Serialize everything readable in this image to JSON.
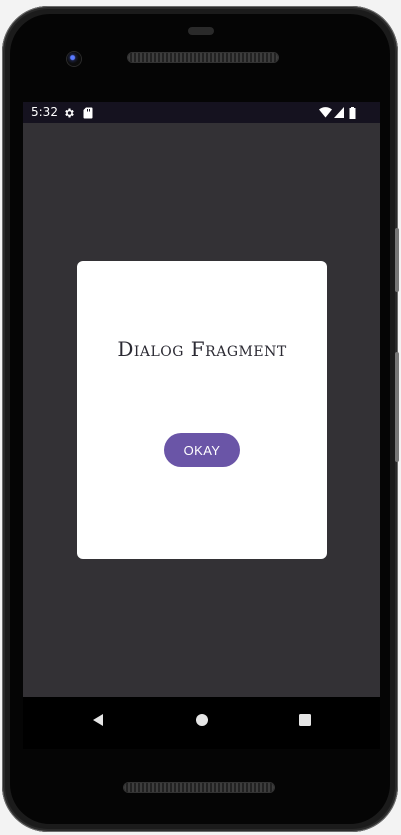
{
  "status_bar": {
    "time": "5:32",
    "icons": [
      "gear-icon",
      "sd-card-icon",
      "wifi-icon",
      "cellular-signal-icon",
      "battery-icon"
    ]
  },
  "dialog": {
    "title": "Dialog Fragment",
    "okay_label": "OKAY"
  },
  "navigation": {
    "icons": [
      "back-icon",
      "home-icon",
      "recents-icon"
    ]
  },
  "colors": {
    "status_bar_bg": "#15121f",
    "app_bg": "#333135",
    "dialog_bg": "#ffffff",
    "accent": "#6a55a7",
    "nav_bar_bg": "#000000"
  }
}
